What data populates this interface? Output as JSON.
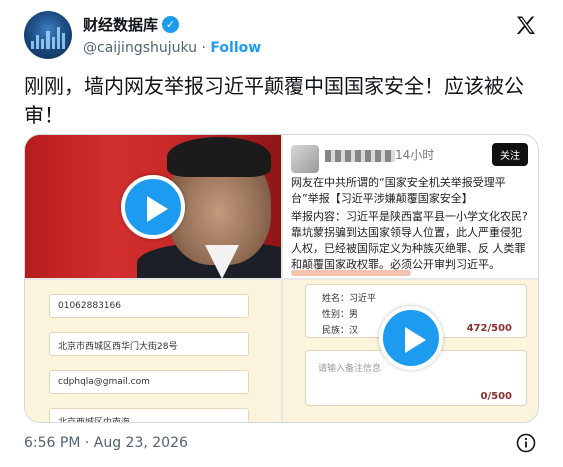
{
  "author": {
    "display_name": "财经数据库",
    "verified_icon": "verified-badge-icon",
    "handle": "@caijingshujuku",
    "separator": "·",
    "follow_label": "Follow"
  },
  "tweet": {
    "text": "刚刚，墙内网友举报习近平颠覆中国国家安全！应该被公审！",
    "timestamp": "6:56 PM · Aug 23, 2026"
  },
  "media": {
    "tile2": {
      "time_ago": "14小时",
      "follow_label": "关注",
      "para1": "网友在中共所谓的“国家安全机关举报受理平台”举报【习近平涉嫌颠覆国家安全】",
      "para2": "举报内容：习近平是陕西富平县一小学文化农民? 靠坑蒙拐骗到达国家领导人位置，此人严重侵犯人权，已经被国际定义为种族灭绝罪、反 人类罪和颠覆国家政权罪。必须公开审判习近平。"
    },
    "tile3": {
      "fields": [
        "01062883166",
        "北京市西城区西华门大街28号",
        "cdphqla@gmail.com",
        "北京西城区中南海"
      ]
    },
    "tile4": {
      "name_row": "姓名：习近平",
      "gender_row": "性别：男",
      "ethnicity_row": "民族：汉",
      "count1": "472/500",
      "placeholder": "请输入备注信息",
      "count2": "0/500"
    }
  },
  "colors": {
    "accent": "#1d9bf0",
    "text": "#0f1419",
    "muted": "#536471"
  }
}
